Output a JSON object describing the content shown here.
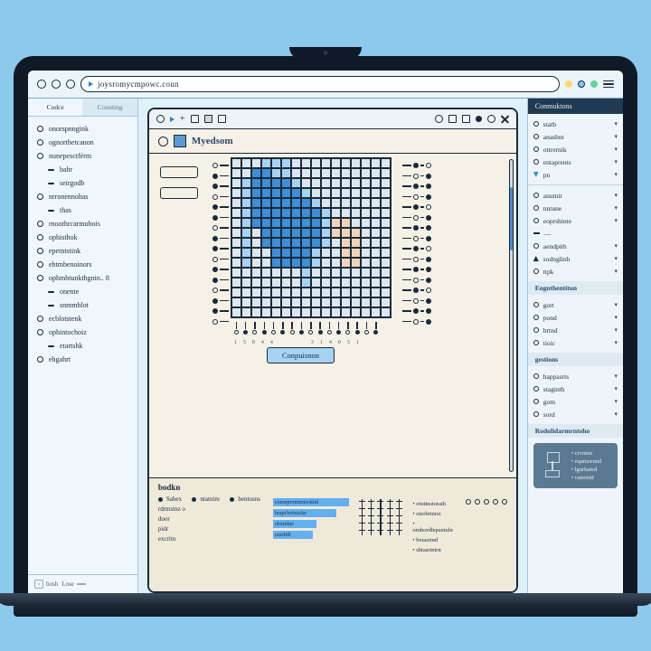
{
  "browser": {
    "url": "joysromycmpowc.coun"
  },
  "left": {
    "tabs": [
      "Codce",
      "Counting"
    ],
    "items": [
      "onorspnngink",
      "ognorthetcanon",
      "nunepesctférm",
      "bahr",
      "seirgodb",
      "nrronennohas",
      "thas",
      "rnoothrcarmubois",
      "ophisthok",
      "epetntstink",
      "ehtmbenoinors",
      "ophmbtunkthgnin.. 8",
      "onente",
      "snmmblot",
      "ecblotstenk",
      "ophintochoiz",
      "etartshk",
      "ehgahrt"
    ],
    "footer": {
      "page": "bosh",
      "tab": "Lose"
    }
  },
  "center": {
    "title": "Myedsom",
    "button": "Conpuisnon",
    "axis": [
      "1",
      "5",
      "8",
      "4",
      "4",
      "",
      "",
      "",
      "",
      "",
      "3",
      "1",
      "4",
      "0",
      "5",
      "1"
    ],
    "bottom": {
      "header": "bodkn",
      "legend": [
        "Sabex",
        "ntatnim",
        "bentosns"
      ],
      "rows": [
        "rdrmstnz o",
        "door",
        "pidr",
        "excritn"
      ],
      "bars": [
        "conseproutnstockinl",
        "brapcbotzocke",
        "obxinbet",
        "ozedith"
      ],
      "textlist": [
        "otutinstorath",
        "oterbrinrst",
        "ornhordlepsntuln",
        "betasrind",
        "shtasrintrn"
      ]
    }
  },
  "right": {
    "header": "Conmuktons",
    "g1": [
      "statb",
      "anasbnt",
      "ottrernik",
      "entaprents",
      "pn"
    ],
    "g2": [
      "anumir",
      "nntune",
      "eoprshinte",
      "—",
      "aendpith",
      "sodnglinh",
      "ttpk"
    ],
    "sub1": "Eognthentitun",
    "g3": [
      "gort",
      "pond",
      "brtnd",
      "tioic"
    ],
    "sub2": "gestions",
    "g4": [
      "happasrts",
      "staginth",
      "gom",
      "sord"
    ],
    "sub3": "Rodolidarmrntoho",
    "card": [
      "crvntsn",
      "eqarnsennd",
      "lgurhated",
      "caternüf"
    ]
  }
}
